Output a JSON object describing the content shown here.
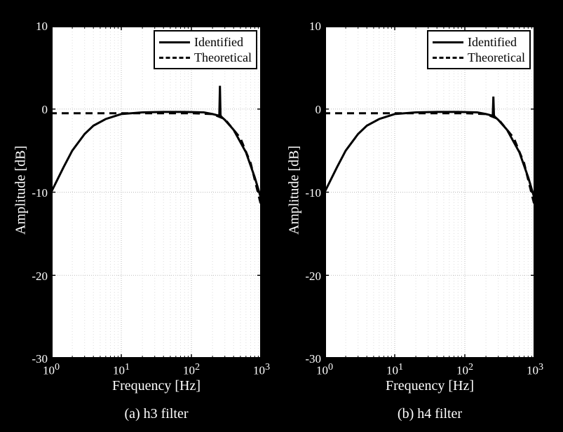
{
  "chart_data": [
    {
      "type": "line",
      "title": "",
      "xlabel": "Frequency [Hz]",
      "ylabel": "Amplitude [dB]",
      "xscale": "log",
      "xlim": [
        1,
        1000
      ],
      "ylim": [
        -30,
        10
      ],
      "xticks": [
        1,
        10,
        100,
        1000
      ],
      "xtick_labels": [
        "10^0",
        "10^1",
        "10^2",
        "10^3"
      ],
      "yticks": [
        -30,
        -20,
        -10,
        0,
        10
      ],
      "grid": true,
      "legend": {
        "position": "upper right",
        "entries": [
          "Identified",
          "Theoretical"
        ]
      },
      "subfig_label": "(a) h3 filter",
      "series": [
        {
          "name": "Identified",
          "style": "solid",
          "x": [
            1,
            1.5,
            2,
            3,
            4,
            6,
            10,
            20,
            40,
            80,
            150,
            200,
            250,
            255,
            260,
            265,
            300,
            400,
            600,
            800,
            1000
          ],
          "y": [
            -10.0,
            -7.0,
            -5.0,
            -3.0,
            -2.0,
            -1.2,
            -0.6,
            -0.4,
            -0.35,
            -0.35,
            -0.4,
            -0.6,
            -0.8,
            2.8,
            -0.7,
            -0.9,
            -1.3,
            -2.5,
            -5.2,
            -8.2,
            -11.5
          ]
        },
        {
          "name": "Theoretical",
          "style": "dashed",
          "x": [
            1,
            10,
            100,
            200,
            300,
            500,
            700,
            1000
          ],
          "y": [
            -0.5,
            -0.5,
            -0.5,
            -0.6,
            -1.2,
            -3.5,
            -6.5,
            -12.5
          ]
        }
      ]
    },
    {
      "type": "line",
      "title": "",
      "xlabel": "Frequency [Hz]",
      "ylabel": "Amplitude [dB]",
      "xscale": "log",
      "xlim": [
        1,
        1000
      ],
      "ylim": [
        -30,
        10
      ],
      "xticks": [
        1,
        10,
        100,
        1000
      ],
      "xtick_labels": [
        "10^0",
        "10^1",
        "10^2",
        "10^3"
      ],
      "yticks": [
        -30,
        -20,
        -10,
        0,
        10
      ],
      "grid": true,
      "legend": {
        "position": "upper right",
        "entries": [
          "Identified",
          "Theoretical"
        ]
      },
      "subfig_label": "(b) h4 filter",
      "series": [
        {
          "name": "Identified",
          "style": "solid",
          "x": [
            1,
            1.5,
            2,
            3,
            4,
            6,
            10,
            20,
            40,
            80,
            150,
            200,
            250,
            255,
            260,
            265,
            300,
            400,
            600,
            800,
            1000
          ],
          "y": [
            -10.0,
            -7.0,
            -5.0,
            -3.0,
            -2.0,
            -1.2,
            -0.6,
            -0.4,
            -0.35,
            -0.35,
            -0.4,
            -0.6,
            -0.8,
            1.5,
            -0.7,
            -0.9,
            -1.3,
            -2.5,
            -5.2,
            -8.2,
            -11.5
          ]
        },
        {
          "name": "Theoretical",
          "style": "dashed",
          "x": [
            1,
            10,
            100,
            200,
            300,
            500,
            700,
            1000
          ],
          "y": [
            -0.5,
            -0.5,
            -0.5,
            -0.6,
            -1.2,
            -3.5,
            -6.5,
            -12.5
          ]
        }
      ]
    }
  ],
  "labels": {
    "xlabel": "Frequency [Hz]",
    "ylabel": "Amplitude [dB]",
    "legend_identified": "Identified",
    "legend_theoretical": "Theoretical",
    "subfig_a": "(a) h3 filter",
    "subfig_b": "(b) h4 filter",
    "xt0": "10",
    "xt1": "10",
    "xt2": "10",
    "xt3": "10",
    "xe0": "0",
    "xe1": "1",
    "xe2": "2",
    "xe3": "3",
    "yt0": "-30",
    "yt1": "-20",
    "yt2": "-10",
    "yt3": "0",
    "yt4": "10"
  }
}
